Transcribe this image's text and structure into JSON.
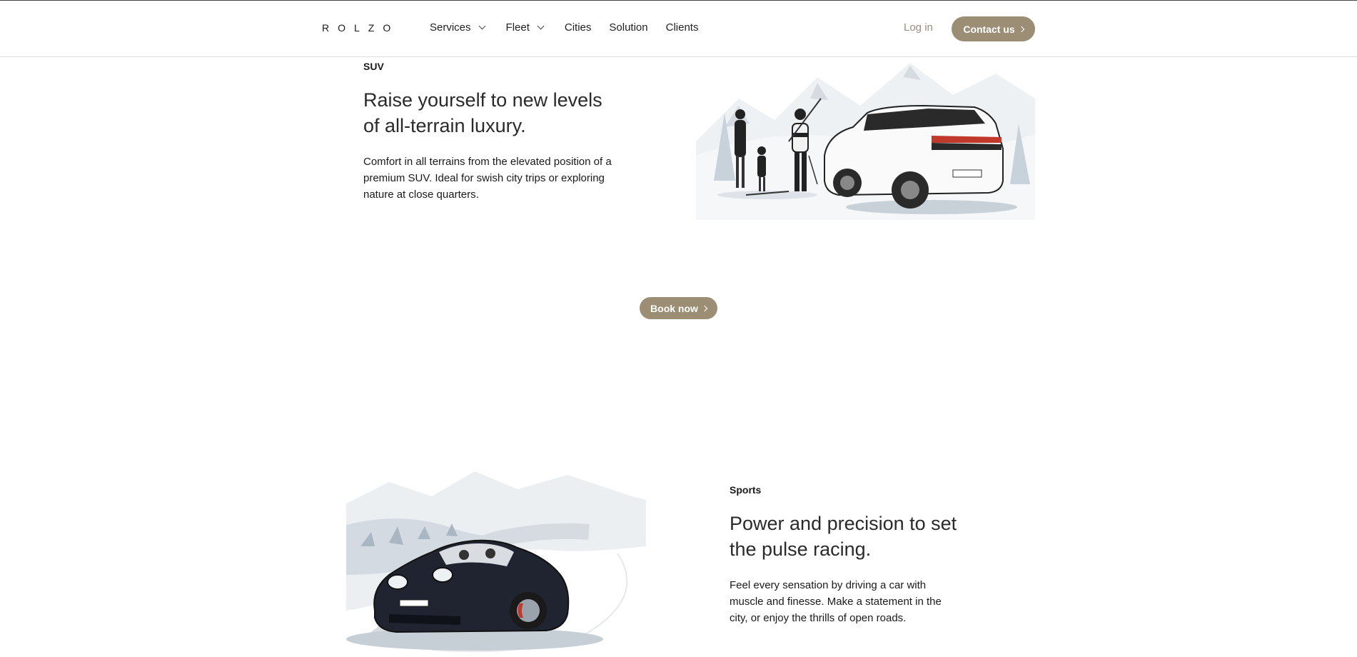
{
  "nav": {
    "logo": "ROLZO",
    "items": [
      {
        "label": "Services"
      },
      {
        "label": "Fleet"
      },
      {
        "label": "Cities"
      },
      {
        "label": "Solution"
      },
      {
        "label": "Clients"
      }
    ],
    "login_label": "Log in",
    "contact_label": "Contact us"
  },
  "suv": {
    "category": "SUV",
    "headline": "Raise yourself to new levels of all-terrain luxury.",
    "body": "Comfort in all terrains from the elevated position of a premium SUV. Ideal for swish city trips or exploring nature at close quarters.",
    "book_label": "Book now"
  },
  "sports": {
    "category": "Sports",
    "headline": "Power and precision to set the pulse racing.",
    "body": "Feel every sensation by driving a car with muscle and finesse. Make a statement in the city, or enjoy the thrills of open roads."
  },
  "colors": {
    "accent": "#9c8e74",
    "login_text": "#9a8f7c",
    "text": "#1a1a1a"
  },
  "icons": {
    "dropdown": "chevron-down-icon",
    "button_arrow": "chevron-right-icon"
  }
}
